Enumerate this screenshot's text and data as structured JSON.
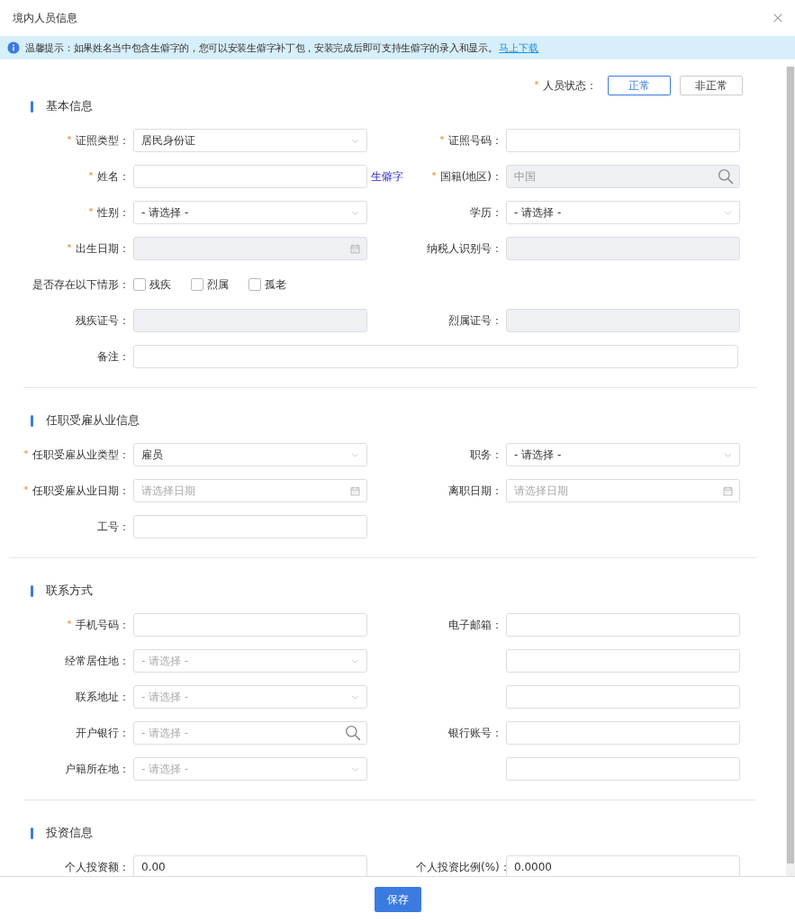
{
  "dialog": {
    "title": "境内人员信息"
  },
  "notice": {
    "text": "温馨提示：如果姓名当中包含生僻字的，您可以安装生僻字补丁包，安装完成后即可支持生僻字的录入和显示。",
    "link": "马上下载"
  },
  "status": {
    "label": "人员状态：",
    "required": true,
    "options": [
      {
        "label": "正常",
        "selected": true
      },
      {
        "label": "非正常",
        "selected": false
      }
    ]
  },
  "sections": [
    {
      "title": "基本信息",
      "rows": [
        [
          {
            "label": "证照类型：",
            "required": true,
            "kind": "select",
            "value": "居民身份证"
          },
          {
            "label": "证照号码：",
            "required": true,
            "kind": "input"
          }
        ],
        [
          {
            "label": "姓名：",
            "required": true,
            "kind": "input",
            "link": "生僻字"
          },
          {
            "label": "国籍(地区)：",
            "required": true,
            "kind": "search",
            "value": "中国",
            "disabled": true
          }
        ],
        [
          {
            "label": "性别：",
            "required": true,
            "kind": "select",
            "value": "- 请选择 -"
          },
          {
            "label": "学历：",
            "required": false,
            "kind": "select",
            "value": "- 请选择 -"
          }
        ],
        [
          {
            "label": "出生日期：",
            "required": true,
            "kind": "date",
            "disabled": true
          },
          {
            "label": "纳税人识别号：",
            "required": false,
            "kind": "input",
            "disabled": true
          }
        ],
        [
          {
            "label": "是否存在以下情形：",
            "required": false,
            "kind": "checks",
            "options": [
              {
                "label": "残疾",
                "checked": false
              },
              {
                "label": "烈属",
                "checked": false
              },
              {
                "label": "孤老",
                "checked": false
              }
            ]
          }
        ],
        [
          {
            "label": "残疾证号：",
            "required": false,
            "kind": "input",
            "disabled": true
          },
          {
            "label": "烈属证号：",
            "required": false,
            "kind": "input",
            "disabled": true
          }
        ],
        [
          {
            "label": "备注：",
            "required": false,
            "kind": "input",
            "full": true
          }
        ]
      ]
    },
    {
      "title": "任职受雇从业信息",
      "rows": [
        [
          {
            "label": "任职受雇从业类型：",
            "required": true,
            "kind": "select",
            "value": "雇员"
          },
          {
            "label": "职务：",
            "required": false,
            "kind": "select",
            "value": "- 请选择 -"
          }
        ],
        [
          {
            "label": "任职受雇从业日期：",
            "required": true,
            "kind": "date",
            "placeholder": "请选择日期"
          },
          {
            "label": "离职日期：",
            "required": false,
            "kind": "date",
            "placeholder": "请选择日期"
          }
        ],
        [
          {
            "label": "工号：",
            "required": false,
            "kind": "input"
          }
        ]
      ]
    },
    {
      "title": "联系方式",
      "rows": [
        [
          {
            "label": "手机号码：",
            "required": true,
            "kind": "input"
          },
          {
            "label": "电子邮箱：",
            "required": false,
            "kind": "input"
          }
        ],
        [
          {
            "label": "经常居住地：",
            "required": false,
            "kind": "select",
            "placeholder": "- 请选择 -"
          },
          {
            "kind": "input"
          }
        ],
        [
          {
            "label": "联系地址：",
            "required": false,
            "kind": "select",
            "placeholder": "- 请选择 -"
          },
          {
            "kind": "input"
          }
        ],
        [
          {
            "label": "开户银行：",
            "required": false,
            "kind": "search",
            "placeholder": "- 请选择 -"
          },
          {
            "label": "银行账号：",
            "required": false,
            "kind": "input"
          }
        ],
        [
          {
            "label": "户籍所在地：",
            "required": false,
            "kind": "select",
            "placeholder": "- 请选择 -"
          },
          {
            "kind": "input"
          }
        ]
      ]
    },
    {
      "title": "投资信息",
      "rows": [
        [
          {
            "label": "个人投资额：",
            "required": false,
            "kind": "input",
            "value": "0.00"
          },
          {
            "label": "个人投资比例(%)：",
            "required": false,
            "kind": "input",
            "value": "0.0000"
          }
        ]
      ]
    }
  ],
  "footer": {
    "button": "保存"
  }
}
